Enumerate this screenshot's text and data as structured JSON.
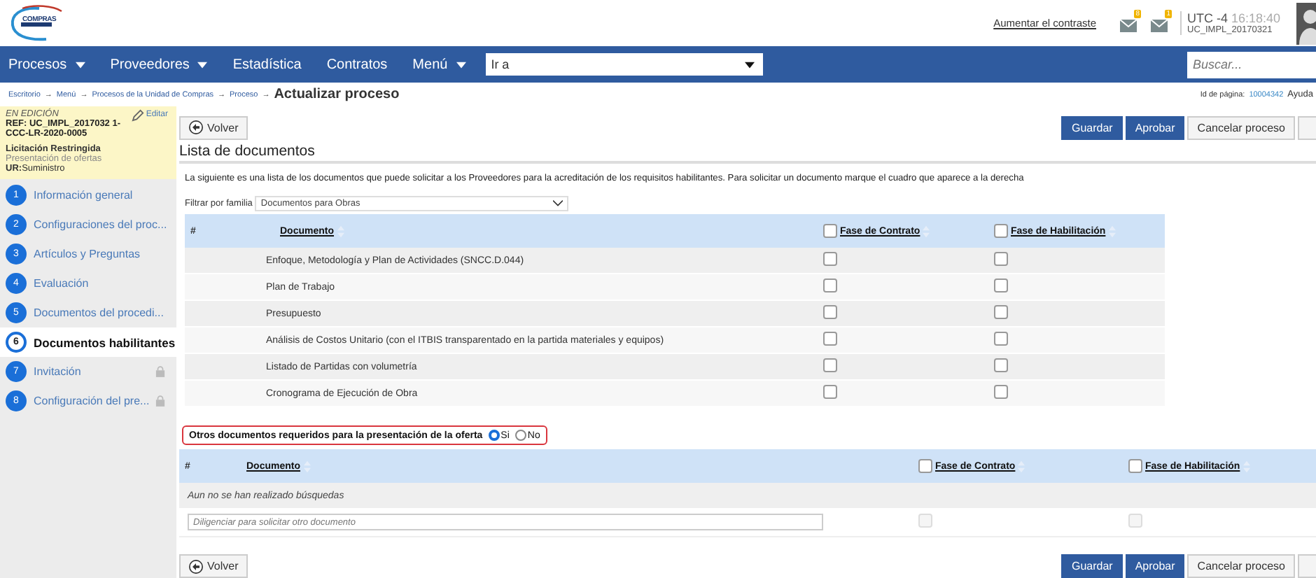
{
  "header": {
    "logo_text": "COMPRAS",
    "contrast_link": "Aumentar el contraste",
    "notification_badges": [
      "8",
      "1"
    ],
    "timezone": "UTC -4",
    "time": "16:18:40",
    "user": "UC_IMPL_20170321"
  },
  "nav": {
    "items": [
      {
        "label": "Procesos",
        "dropdown": true
      },
      {
        "label": "Proveedores",
        "dropdown": true
      },
      {
        "label": "Estadística",
        "dropdown": false
      },
      {
        "label": "Contratos",
        "dropdown": false
      },
      {
        "label": "Menú",
        "dropdown": true
      }
    ],
    "goto": "Ir a",
    "search_placeholder": "Buscar..."
  },
  "breadcrumb": {
    "items": [
      "Escritorio",
      "Menú",
      "Procesos de la Unidad de Compras",
      "Proceso"
    ],
    "separator": "→",
    "current": "Actualizar proceso",
    "page_id_label": "Id de página:",
    "page_id": "10004342",
    "help": "Ayuda"
  },
  "process_card": {
    "status": "EN EDICIÓN",
    "edit": "Editar",
    "ref": "REF: UC_IMPL_2017032 1-CCC-LR-2020-0005",
    "type": "Licitación Restringida",
    "phase": "Presentación de ofertas",
    "unit_label": "UR:",
    "unit": "Suministro"
  },
  "steps": [
    {
      "number": "1",
      "label": "Información general",
      "selected": false,
      "locked": false
    },
    {
      "number": "2",
      "label": "Configuraciones del proc...",
      "selected": false,
      "locked": false
    },
    {
      "number": "3",
      "label": "Artículos y Preguntas",
      "selected": false,
      "locked": false
    },
    {
      "number": "4",
      "label": "Evaluación",
      "selected": false,
      "locked": false
    },
    {
      "number": "5",
      "label": "Documentos del procedi...",
      "selected": false,
      "locked": false
    },
    {
      "number": "6",
      "label": "Documentos habilitantes",
      "selected": true,
      "locked": false
    },
    {
      "number": "7",
      "label": "Invitación",
      "selected": false,
      "locked": true
    },
    {
      "number": "8",
      "label": "Configuración del pre...",
      "selected": false,
      "locked": true
    }
  ],
  "back_button": "Volver",
  "actions": [
    {
      "label": "Guardar",
      "kind": "primary"
    },
    {
      "label": "Aprobar",
      "kind": "primary"
    },
    {
      "label": "Cancelar proceso",
      "kind": "secondary"
    }
  ],
  "bottom_back_button": "Volver",
  "bottom_actions": [
    {
      "label": "Guardar",
      "kind": "primary"
    },
    {
      "label": "Aprobar",
      "kind": "primary"
    },
    {
      "label": "Cancelar proceso",
      "kind": "secondary"
    }
  ],
  "section_title": "Lista de documentos",
  "description": "La siguiente es una lista de los documentos que puede solicitar a los Proveedores para la acreditación de los requisitos habilitantes. Para solicitar un documento marque el cuadro que aparece a la derecha",
  "filter": {
    "label": "Filtrar por familia",
    "value": "Documentos para Obras"
  },
  "documents_table": {
    "columns": [
      {
        "label": "#",
        "kind": "plain"
      },
      {
        "label": "Documento",
        "kind": "link"
      },
      {
        "label": "Fase de Contrato",
        "checked": false,
        "kind": "check"
      },
      {
        "label": "Fase de Habilitación",
        "checked": false,
        "kind": "check"
      }
    ],
    "rows": [
      {
        "document": "Enfoque, Metodología y Plan de Actividades (SNCC.D.044)",
        "contract": false,
        "qualification": false
      },
      {
        "document": "Plan de Trabajo",
        "contract": false,
        "qualification": false
      },
      {
        "document": "Presupuesto",
        "contract": false,
        "qualification": false
      },
      {
        "document": "Análisis de Costos Unitario (con el ITBIS transparentado en la partida materiales y equipos)",
        "contract": false,
        "qualification": false
      },
      {
        "document": "Listado de Partidas con volumetría",
        "contract": false,
        "qualification": false
      },
      {
        "document": "Cronograma de Ejecución de Obra",
        "contract": false,
        "qualification": false
      }
    ]
  },
  "other_documents": {
    "question": "Otros documentos requeridos para la presentación de la oferta",
    "options": [
      {
        "label": "Si",
        "selected": true
      },
      {
        "label": "No",
        "selected": false
      }
    ],
    "columns": [
      {
        "label": "#",
        "kind": "plain"
      },
      {
        "label": "Documento",
        "kind": "link"
      },
      {
        "label": "Fase de Contrato",
        "checked": false,
        "kind": "check"
      },
      {
        "label": "Fase de Habilitación",
        "checked": false,
        "kind": "check"
      }
    ],
    "empty_message": "Aun no se han realizado búsquedas",
    "input_placeholder": "Diligenciar para solicitar otro documento",
    "input_checks_disabled": true
  }
}
